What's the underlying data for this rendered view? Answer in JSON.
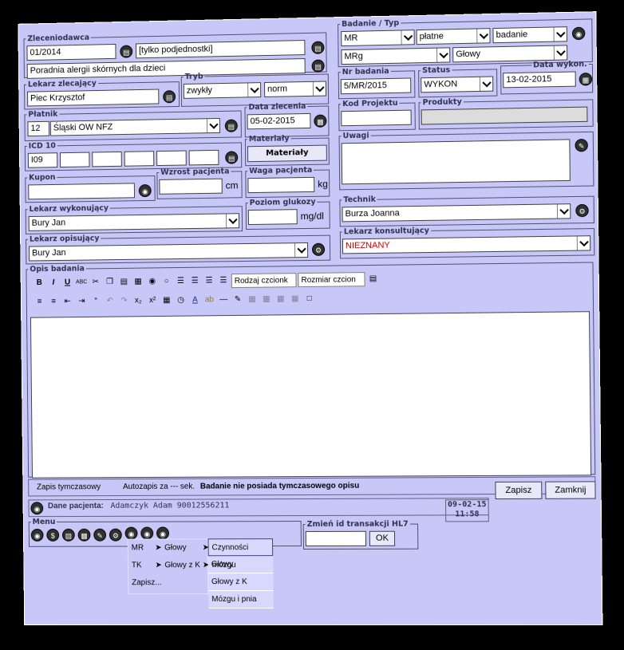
{
  "zleceniodawca": {
    "legend": "Zleceniodawca",
    "code": "01/2014",
    "unit": "[tylko podjednostki]",
    "name": "Poradnia alergii skórnych dla dzieci"
  },
  "badanie": {
    "legend": "Badanie / Typ",
    "modality": "MR",
    "payment": "płatne",
    "kind": "badanie",
    "subtype": "MRg",
    "region": "Głowy"
  },
  "lekarz_zlecajacy": {
    "legend": "Lekarz zlecający",
    "value": "Piec Krzysztof"
  },
  "tryb": {
    "legend": "Tryb",
    "mode": "zwykły",
    "priority": "norm"
  },
  "nr_badania": {
    "legend": "Nr badania",
    "value": "5/MR/2015"
  },
  "status": {
    "legend": "Status",
    "value": "WYKON"
  },
  "data_wykon": {
    "legend": "Data wykon.",
    "value": "13-02-2015"
  },
  "platnik": {
    "legend": "Płatnik",
    "code": "12",
    "name": "Śląski OW NFZ"
  },
  "data_zlecenia": {
    "legend": "Data zlecenia",
    "value": "05-02-2015"
  },
  "kod_projektu": {
    "legend": "Kod Projektu",
    "value": ""
  },
  "produkty": {
    "legend": "Produkty",
    "value": ""
  },
  "materialy": {
    "legend": "Materiały",
    "button": "Materiały"
  },
  "icd": {
    "legend": "ICD 10",
    "first": "I09"
  },
  "uwagi": {
    "legend": "Uwagi",
    "value": ""
  },
  "kupon": {
    "legend": "Kupon",
    "value": ""
  },
  "wzrost": {
    "legend": "Wzrost pacjenta",
    "unit": "cm",
    "value": ""
  },
  "waga": {
    "legend": "Waga pacjenta",
    "unit": "kg",
    "value": ""
  },
  "lekarz_wykonujacy": {
    "legend": "Lekarz wykonujący",
    "value": "Bury Jan"
  },
  "glukoza": {
    "legend": "Poziom glukozy",
    "unit": "mg/dl",
    "value": ""
  },
  "technik": {
    "legend": "Technik",
    "value": "Burza Joanna"
  },
  "lekarz_opisujacy": {
    "legend": "Lekarz opisujący",
    "value": "Bury Jan"
  },
  "lekarz_konsultujacy": {
    "legend": "Lekarz konsultujący",
    "value": "NIEZNANY"
  },
  "opis": {
    "legend": "Opis badania",
    "font_name": "Rodzaj czcionk",
    "font_size": "Rozmiar czcion"
  },
  "status_bar": {
    "tab": "Zapis tymczasowy",
    "autosave": "Autozapis za --- sek.",
    "message": "Badanie nie posiada tymczasowego opisu",
    "save": "Zapisz",
    "close": "Zamknij"
  },
  "pacjent": {
    "label": "Dane pacjenta:",
    "value": "Adamczyk Adam 90012556211",
    "date": "09-02-15",
    "time": "11:58"
  },
  "menu": {
    "legend": "Menu",
    "items": [
      {
        "label": "MR"
      },
      {
        "label": "TK"
      },
      {
        "label": "Zapisz..."
      }
    ],
    "sub1": [
      {
        "label": "Głowy"
      },
      {
        "label": "Głowy z K"
      }
    ],
    "sub2": [
      {
        "label": "Czynności mózgu"
      },
      {
        "label": "Głowy"
      },
      {
        "label": "Głowy z K"
      },
      {
        "label": "Mózgu i pnia"
      }
    ]
  },
  "hl7": {
    "legend": "Zmień id transakcji HL7",
    "ok": "OK",
    "value": ""
  }
}
